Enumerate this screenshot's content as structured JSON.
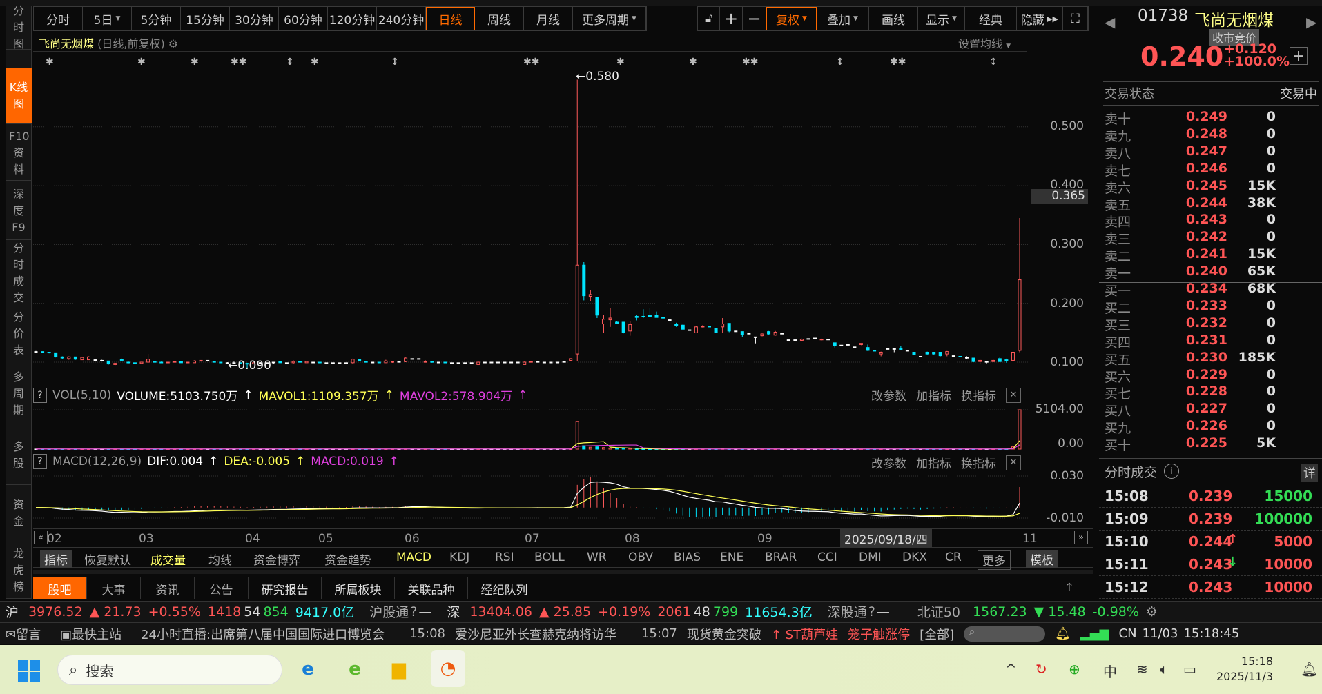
{
  "sidebar": {
    "items": [
      "分时图",
      "K线图",
      "F10资料",
      "深度F9",
      "分时成交",
      "分价表",
      "多周期",
      "多股",
      "资金",
      "龙虎榜"
    ]
  },
  "toolbar": {
    "periods": [
      "分时",
      "5日",
      "5分钟",
      "15分钟",
      "30分钟",
      "60分钟",
      "120分钟",
      "240分钟",
      "日线",
      "周线",
      "月线",
      "更多周期"
    ],
    "active_period": "日线",
    "zoom_in": "+",
    "zoom_out": "−",
    "tools": [
      "复权",
      "叠加",
      "画线",
      "显示",
      "经典",
      "隐藏"
    ]
  },
  "chart": {
    "stock_name": "飞尚无烟煤",
    "subtitle": "(日线,前复权)",
    "set_ma": "设置均线",
    "price_axis": [
      "0.500",
      "0.400",
      "0.300",
      "0.200",
      "0.100"
    ],
    "current_price_badge": "0.365",
    "high_label": "0.580",
    "low_label": "0.090",
    "vol_header": {
      "name": "VOL(5,10)",
      "volume": "VOLUME:5103.750万",
      "mavol1": "MAVOL1:1109.357万",
      "mavol2": "MAVOL2:578.904万"
    },
    "vol_axis": [
      "5104.00",
      "0.00"
    ],
    "macd_header": {
      "name": "MACD(12,26,9)",
      "dif": "DIF:0.004",
      "dea": "DEA:-0.005",
      "macd": "MACD:0.019"
    },
    "macd_axis": [
      "0.030",
      "-0.010"
    ],
    "pane_buttons": [
      "改参数",
      "加指标",
      "换指标"
    ],
    "help": "?",
    "months": [
      "02",
      "03",
      "04",
      "05",
      "06",
      "07",
      "08",
      "09",
      "11"
    ],
    "date_badge": "2025/09/18/四"
  },
  "chart_data": {
    "type": "candlestick",
    "ylim": [
      0.08,
      0.6
    ],
    "colors": {
      "up": "#ff5a5a",
      "down": "#00e5ff",
      "flat": "#ffffff",
      "mavol1": "#ffff55",
      "mavol2": "#e040e0",
      "dif": "#ffffff",
      "dea": "#ffff55"
    },
    "ohlc": [
      [
        0.118,
        0.119,
        0.117,
        0.118
      ],
      [
        0.118,
        0.118,
        0.116,
        0.117
      ],
      [
        0.117,
        0.117,
        0.115,
        0.116
      ],
      [
        0.116,
        0.116,
        0.108,
        0.109
      ],
      [
        0.109,
        0.11,
        0.105,
        0.107
      ],
      [
        0.106,
        0.11,
        0.104,
        0.109
      ],
      [
        0.109,
        0.109,
        0.104,
        0.105
      ],
      [
        0.104,
        0.109,
        0.104,
        0.108
      ],
      [
        0.104,
        0.11,
        0.104,
        0.109
      ],
      [
        0.104,
        0.105,
        0.103,
        0.104
      ],
      [
        0.103,
        0.104,
        0.102,
        0.103
      ],
      [
        0.102,
        0.102,
        0.096,
        0.097
      ],
      [
        0.096,
        0.099,
        0.095,
        0.098
      ],
      [
        0.105,
        0.106,
        0.103,
        0.103
      ],
      [
        0.1,
        0.101,
        0.098,
        0.099
      ],
      [
        0.099,
        0.1,
        0.098,
        0.098
      ],
      [
        0.098,
        0.1,
        0.097,
        0.1
      ],
      [
        0.1,
        0.114,
        0.099,
        0.105
      ],
      [
        0.101,
        0.101,
        0.1,
        0.1
      ],
      [
        0.1,
        0.101,
        0.099,
        0.099
      ],
      [
        0.099,
        0.1,
        0.099,
        0.1
      ],
      [
        0.1,
        0.101,
        0.1,
        0.101
      ],
      [
        0.101,
        0.101,
        0.099,
        0.099
      ],
      [
        0.099,
        0.1,
        0.099,
        0.1
      ],
      [
        0.099,
        0.103,
        0.099,
        0.102
      ],
      [
        0.102,
        0.103,
        0.101,
        0.103
      ],
      [
        0.103,
        0.103,
        0.103,
        0.103
      ],
      [
        0.101,
        0.102,
        0.1,
        0.1
      ],
      [
        0.1,
        0.1,
        0.099,
        0.099
      ],
      [
        0.099,
        0.1,
        0.099,
        0.099
      ],
      [
        0.099,
        0.101,
        0.097,
        0.099
      ],
      [
        0.099,
        0.099,
        0.098,
        0.098
      ],
      [
        0.098,
        0.099,
        0.09,
        0.097
      ],
      [
        0.097,
        0.099,
        0.097,
        0.099
      ],
      [
        0.099,
        0.1,
        0.099,
        0.099
      ],
      [
        0.099,
        0.099,
        0.099,
        0.099
      ],
      [
        0.1,
        0.1,
        0.097,
        0.1
      ],
      [
        0.101,
        0.102,
        0.099,
        0.099
      ],
      [
        0.099,
        0.099,
        0.099,
        0.099
      ],
      [
        0.099,
        0.103,
        0.097,
        0.101
      ],
      [
        0.101,
        0.101,
        0.1,
        0.1
      ],
      [
        0.099,
        0.101,
        0.099,
        0.101
      ],
      [
        0.1,
        0.1,
        0.1,
        0.1
      ],
      [
        0.1,
        0.1,
        0.098,
        0.099
      ],
      [
        0.099,
        0.099,
        0.099,
        0.099
      ],
      [
        0.099,
        0.099,
        0.097,
        0.099
      ],
      [
        0.099,
        0.099,
        0.097,
        0.099
      ],
      [
        0.099,
        0.099,
        0.097,
        0.099
      ],
      [
        0.099,
        0.106,
        0.097,
        0.105
      ],
      [
        0.105,
        0.105,
        0.102,
        0.102
      ],
      [
        0.101,
        0.101,
        0.1,
        0.1
      ],
      [
        0.1,
        0.1,
        0.1,
        0.1
      ],
      [
        0.1,
        0.1,
        0.099,
        0.099
      ],
      [
        0.099,
        0.104,
        0.099,
        0.102
      ],
      [
        0.1,
        0.101,
        0.099,
        0.101
      ],
      [
        0.101,
        0.101,
        0.101,
        0.101
      ],
      [
        0.101,
        0.108,
        0.1,
        0.107
      ],
      [
        0.106,
        0.106,
        0.106,
        0.106
      ],
      [
        0.106,
        0.106,
        0.106,
        0.106
      ],
      [
        0.1,
        0.103,
        0.1,
        0.101
      ],
      [
        0.101,
        0.102,
        0.099,
        0.1
      ],
      [
        0.1,
        0.1,
        0.1,
        0.1
      ],
      [
        0.1,
        0.1,
        0.099,
        0.099
      ],
      [
        0.099,
        0.099,
        0.099,
        0.099
      ],
      [
        0.099,
        0.099,
        0.099,
        0.099
      ],
      [
        0.099,
        0.099,
        0.099,
        0.099
      ],
      [
        0.099,
        0.099,
        0.099,
        0.099
      ],
      [
        0.096,
        0.101,
        0.096,
        0.1
      ],
      [
        0.1,
        0.1,
        0.1,
        0.1
      ],
      [
        0.1,
        0.1,
        0.1,
        0.1
      ],
      [
        0.1,
        0.1,
        0.098,
        0.1
      ],
      [
        0.1,
        0.1,
        0.1,
        0.1
      ],
      [
        0.1,
        0.1,
        0.1,
        0.1
      ],
      [
        0.1,
        0.1,
        0.1,
        0.1
      ],
      [
        0.096,
        0.101,
        0.096,
        0.1
      ],
      [
        0.1,
        0.101,
        0.1,
        0.101
      ],
      [
        0.101,
        0.101,
        0.101,
        0.101
      ],
      [
        0.1,
        0.1,
        0.1,
        0.1
      ],
      [
        0.1,
        0.1,
        0.1,
        0.1
      ],
      [
        0.1,
        0.1,
        0.1,
        0.1
      ],
      [
        0.101,
        0.101,
        0.101,
        0.101
      ],
      [
        0.103,
        0.106,
        0.102,
        0.106
      ],
      [
        0.114,
        0.58,
        0.102,
        0.265
      ],
      [
        0.265,
        0.27,
        0.205,
        0.213
      ],
      [
        0.212,
        0.222,
        0.204,
        0.215
      ],
      [
        0.21,
        0.21,
        0.175,
        0.18
      ],
      [
        0.165,
        0.18,
        0.15,
        0.173
      ],
      [
        0.172,
        0.192,
        0.16,
        0.175
      ],
      [
        0.168,
        0.17,
        0.165,
        0.166
      ],
      [
        0.168,
        0.168,
        0.149,
        0.151
      ],
      [
        0.153,
        0.17,
        0.145,
        0.164
      ],
      [
        0.178,
        0.18,
        0.171,
        0.176
      ],
      [
        0.178,
        0.19,
        0.175,
        0.177
      ],
      [
        0.18,
        0.192,
        0.177,
        0.177
      ],
      [
        0.18,
        0.186,
        0.176,
        0.176
      ],
      [
        0.176,
        0.176,
        0.174,
        0.175
      ],
      [
        0.172,
        0.172,
        0.172,
        0.172
      ],
      [
        0.165,
        0.167,
        0.16,
        0.162
      ],
      [
        0.163,
        0.164,
        0.156,
        0.156
      ],
      [
        0.155,
        0.155,
        0.155,
        0.155
      ],
      [
        0.15,
        0.161,
        0.15,
        0.16
      ],
      [
        0.16,
        0.163,
        0.159,
        0.161
      ],
      [
        0.161,
        0.161,
        0.16,
        0.16
      ],
      [
        0.158,
        0.158,
        0.15,
        0.151
      ],
      [
        0.16,
        0.175,
        0.15,
        0.165
      ],
      [
        0.166,
        0.166,
        0.151,
        0.153
      ],
      [
        0.153,
        0.153,
        0.153,
        0.153
      ],
      [
        0.152,
        0.152,
        0.143,
        0.147
      ],
      [
        0.149,
        0.149,
        0.149,
        0.149
      ],
      [
        0.143,
        0.143,
        0.132,
        0.143
      ],
      [
        0.145,
        0.149,
        0.144,
        0.148
      ],
      [
        0.152,
        0.153,
        0.147,
        0.148
      ],
      [
        0.146,
        0.153,
        0.145,
        0.151
      ],
      [
        0.149,
        0.15,
        0.149,
        0.149
      ],
      [
        0.138,
        0.138,
        0.138,
        0.138
      ],
      [
        0.138,
        0.138,
        0.138,
        0.138
      ],
      [
        0.137,
        0.14,
        0.136,
        0.139
      ],
      [
        0.14,
        0.14,
        0.14,
        0.14
      ],
      [
        0.141,
        0.141,
        0.141,
        0.141
      ],
      [
        0.138,
        0.14,
        0.137,
        0.139
      ],
      [
        0.139,
        0.139,
        0.139,
        0.139
      ],
      [
        0.133,
        0.133,
        0.125,
        0.128
      ],
      [
        0.129,
        0.129,
        0.129,
        0.129
      ],
      [
        0.13,
        0.131,
        0.129,
        0.13
      ],
      [
        0.126,
        0.126,
        0.126,
        0.126
      ],
      [
        0.13,
        0.132,
        0.129,
        0.132
      ],
      [
        0.125,
        0.13,
        0.119,
        0.12
      ],
      [
        0.12,
        0.12,
        0.119,
        0.119
      ],
      [
        0.114,
        0.118,
        0.11,
        0.117
      ],
      [
        0.123,
        0.123,
        0.123,
        0.123
      ],
      [
        0.123,
        0.123,
        0.117,
        0.123
      ],
      [
        0.124,
        0.128,
        0.12,
        0.121
      ],
      [
        0.12,
        0.12,
        0.12,
        0.12
      ],
      [
        0.117,
        0.117,
        0.112,
        0.113
      ],
      [
        0.11,
        0.11,
        0.11,
        0.11
      ],
      [
        0.117,
        0.118,
        0.113,
        0.114
      ],
      [
        0.117,
        0.117,
        0.113,
        0.114
      ],
      [
        0.117,
        0.117,
        0.11,
        0.111
      ],
      [
        0.114,
        0.119,
        0.11,
        0.118
      ],
      [
        0.111,
        0.111,
        0.111,
        0.111
      ],
      [
        0.11,
        0.11,
        0.109,
        0.109
      ],
      [
        0.108,
        0.11,
        0.105,
        0.108
      ],
      [
        0.107,
        0.107,
        0.1,
        0.101
      ],
      [
        0.101,
        0.104,
        0.097,
        0.103
      ],
      [
        0.101,
        0.101,
        0.098,
        0.101
      ],
      [
        0.101,
        0.104,
        0.1,
        0.103
      ],
      [
        0.106,
        0.109,
        0.1,
        0.101
      ],
      [
        0.104,
        0.106,
        0.099,
        0.103
      ],
      [
        0.103,
        0.118,
        0.102,
        0.117
      ],
      [
        0.12,
        0.345,
        0.117,
        0.24
      ]
    ],
    "volume_default_wan": 8,
    "volume_points_wan": [
      [
        40,
        30
      ],
      [
        82,
        3600
      ],
      [
        83,
        450
      ],
      [
        84,
        250
      ],
      [
        85,
        300
      ],
      [
        86,
        200
      ],
      [
        87,
        150
      ],
      [
        88,
        100
      ],
      [
        89,
        150
      ],
      [
        90,
        100
      ],
      [
        104,
        60
      ],
      [
        148,
        300
      ],
      [
        149,
        5103.75
      ]
    ],
    "vol_max_wan": 5104,
    "macd_range": [
      -0.01,
      0.03
    ]
  },
  "indicator_tabs": [
    "指标",
    "恢复默认",
    "成交量",
    "均线",
    "资金博弈",
    "资金趋势",
    "MACD",
    "KDJ",
    "RSI",
    "BOLL",
    "WR",
    "OBV",
    "BIAS",
    "ENE",
    "BRAR",
    "CCI",
    "DMI",
    "DKX",
    "CR",
    "更多",
    "模板"
  ],
  "bottom_tabs": [
    "股吧",
    "大事",
    "资讯",
    "公告",
    "研究报告",
    "所属板块",
    "关联品种",
    "经纪队列"
  ],
  "quote": {
    "code": "01738",
    "name": "飞尚无烟煤",
    "session": "收市竞价",
    "price": "0.240",
    "change": "+0.120",
    "change_pct": "+100.0%",
    "status_label": "交易状态",
    "status_value": "交易中",
    "asks": [
      {
        "label": "卖十",
        "price": "0.249",
        "vol": "0"
      },
      {
        "label": "卖九",
        "price": "0.248",
        "vol": "0"
      },
      {
        "label": "卖八",
        "price": "0.247",
        "vol": "0"
      },
      {
        "label": "卖七",
        "price": "0.246",
        "vol": "0"
      },
      {
        "label": "卖六",
        "price": "0.245",
        "vol": "15K"
      },
      {
        "label": "卖五",
        "price": "0.244",
        "vol": "38K"
      },
      {
        "label": "卖四",
        "price": "0.243",
        "vol": "0"
      },
      {
        "label": "卖三",
        "price": "0.242",
        "vol": "0"
      },
      {
        "label": "卖二",
        "price": "0.241",
        "vol": "15K"
      },
      {
        "label": "卖一",
        "price": "0.240",
        "vol": "65K"
      }
    ],
    "bids": [
      {
        "label": "买一",
        "price": "0.234",
        "vol": "68K"
      },
      {
        "label": "买二",
        "price": "0.233",
        "vol": "0"
      },
      {
        "label": "买三",
        "price": "0.232",
        "vol": "0"
      },
      {
        "label": "买四",
        "price": "0.231",
        "vol": "0"
      },
      {
        "label": "买五",
        "price": "0.230",
        "vol": "185K"
      },
      {
        "label": "买六",
        "price": "0.229",
        "vol": "0"
      },
      {
        "label": "买七",
        "price": "0.228",
        "vol": "0"
      },
      {
        "label": "买八",
        "price": "0.227",
        "vol": "0"
      },
      {
        "label": "买九",
        "price": "0.226",
        "vol": "0"
      },
      {
        "label": "买十",
        "price": "0.225",
        "vol": "5K"
      }
    ],
    "ticks_title": "分时成交",
    "ticks_detail": "详",
    "ticks": [
      {
        "time": "15:08",
        "price": "0.239",
        "dir": "",
        "vol": "15000",
        "vcolor": "#33dd55"
      },
      {
        "time": "15:09",
        "price": "0.239",
        "dir": "",
        "vol": "100000",
        "vcolor": "#33dd55"
      },
      {
        "time": "15:10",
        "price": "0.244",
        "dir": "↑",
        "vol": "5000",
        "vcolor": "#ff5555"
      },
      {
        "time": "15:11",
        "price": "0.243",
        "dir": "↓",
        "vol": "10000",
        "vcolor": "#ff5555"
      },
      {
        "time": "15:12",
        "price": "0.243",
        "dir": "",
        "vol": "10000",
        "vcolor": "#ff5555"
      }
    ]
  },
  "status_bar": {
    "sh": "沪",
    "sh_idx": "3976.52",
    "sh_chg": "▲ 21.73",
    "sh_pct": "+0.55%",
    "sh_up": "1418",
    "sh_flat": "54",
    "sh_down": "854",
    "sh_amt": "9417.0亿",
    "sh_connect": "沪股通",
    "sz": "深",
    "sz_idx": "13404.06",
    "sz_chg": "▲ 25.85",
    "sz_pct": "+0.19%",
    "sz_up": "2061",
    "sz_flat": "48",
    "sz_down": "799",
    "sz_amt": "11654.3亿",
    "sz_connect": "深股通",
    "bz": "北证50",
    "bz_idx": "1567.23",
    "bz_chg": "▼ 15.48",
    "bz_pct": "-0.98%",
    "dash": "—",
    "help": "?"
  },
  "ticker": {
    "msg": "留言",
    "site": "最快主站",
    "live": "24小时直播",
    "n1": ":出席第八届中国国际进口博览会",
    "t2": "15:08",
    "n2": "爱沙尼亚外长查赫克纳将访华",
    "t3": "15:07",
    "n3": "现货黄金突破",
    "alert1": "↑ ST葫芦娃",
    "alert2": "笼子触涨停",
    "all": "[全部]",
    "region": "CN",
    "date": "11/03",
    "time": "15:18:45"
  },
  "taskbar": {
    "search": "搜索",
    "ime": "中",
    "time": "15:18",
    "date": "2025/11/3"
  }
}
